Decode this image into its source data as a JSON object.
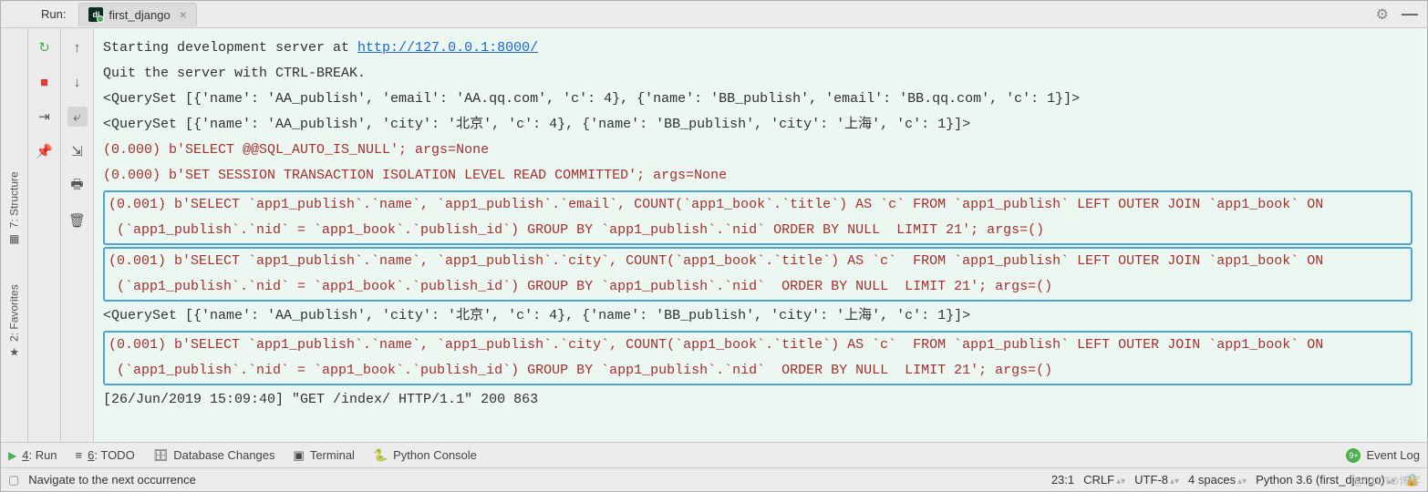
{
  "header": {
    "run_label": "Run:",
    "tab_label": "first_django"
  },
  "side_tabs": {
    "structure": "7: Structure",
    "favorites": "2: Favorites"
  },
  "console": {
    "line1_prefix": "Starting development server at ",
    "line1_url": "http://127.0.0.1:8000/",
    "line2": "Quit the server with CTRL-BREAK.",
    "line3": "<QuerySet [{'name': 'AA_publish', 'email': 'AA.qq.com', 'c': 4}, {'name': 'BB_publish', 'email': 'BB.qq.com', 'c': 1}]>",
    "line4": "<QuerySet [{'name': 'AA_publish', 'city': '北京', 'c': 4}, {'name': 'BB_publish', 'city': '上海', 'c': 1}]>",
    "sql1": "(0.000) b'SELECT @@SQL_AUTO_IS_NULL'; args=None",
    "sql2": "(0.000) b'SET SESSION TRANSACTION ISOLATION LEVEL READ COMMITTED'; args=None",
    "box1": "(0.001) b'SELECT `app1_publish`.`name`, `app1_publish`.`email`, COUNT(`app1_book`.`title`) AS `c` FROM `app1_publish` LEFT OUTER JOIN `app1_book` ON\n (`app1_publish`.`nid` = `app1_book`.`publish_id`) GROUP BY `app1_publish`.`nid` ORDER BY NULL  LIMIT 21'; args=()",
    "box2": "(0.001) b'SELECT `app1_publish`.`name`, `app1_publish`.`city`, COUNT(`app1_book`.`title`) AS `c`  FROM `app1_publish` LEFT OUTER JOIN `app1_book` ON\n (`app1_publish`.`nid` = `app1_book`.`publish_id`) GROUP BY `app1_publish`.`nid`  ORDER BY NULL  LIMIT 21'; args=()",
    "line_qs2": "<QuerySet [{'name': 'AA_publish', 'city': '北京', 'c': 4}, {'name': 'BB_publish', 'city': '上海', 'c': 1}]>",
    "box3": "(0.001) b'SELECT `app1_publish`.`name`, `app1_publish`.`city`, COUNT(`app1_book`.`title`) AS `c`  FROM `app1_publish` LEFT OUTER JOIN `app1_book` ON\n (`app1_publish`.`nid` = `app1_book`.`publish_id`) GROUP BY `app1_publish`.`nid`  ORDER BY NULL  LIMIT 21'; args=()",
    "http": "[26/Jun/2019 15:09:40] \"GET /index/ HTTP/1.1\" 200 863"
  },
  "bottom": {
    "run": "4: Run",
    "todo": "6: TODO",
    "db": "Database Changes",
    "terminal": "Terminal",
    "pyconsole": "Python Console",
    "eventlog": "Event Log",
    "badge": "9+"
  },
  "status": {
    "nav": "Navigate to the next occurrence",
    "pos": "23:1",
    "lineend": "CRLF",
    "enc": "UTF-8",
    "indent": "4 spaces",
    "interp": "Python 3.6 (first_django)"
  },
  "watermark": "@51CTO博客"
}
